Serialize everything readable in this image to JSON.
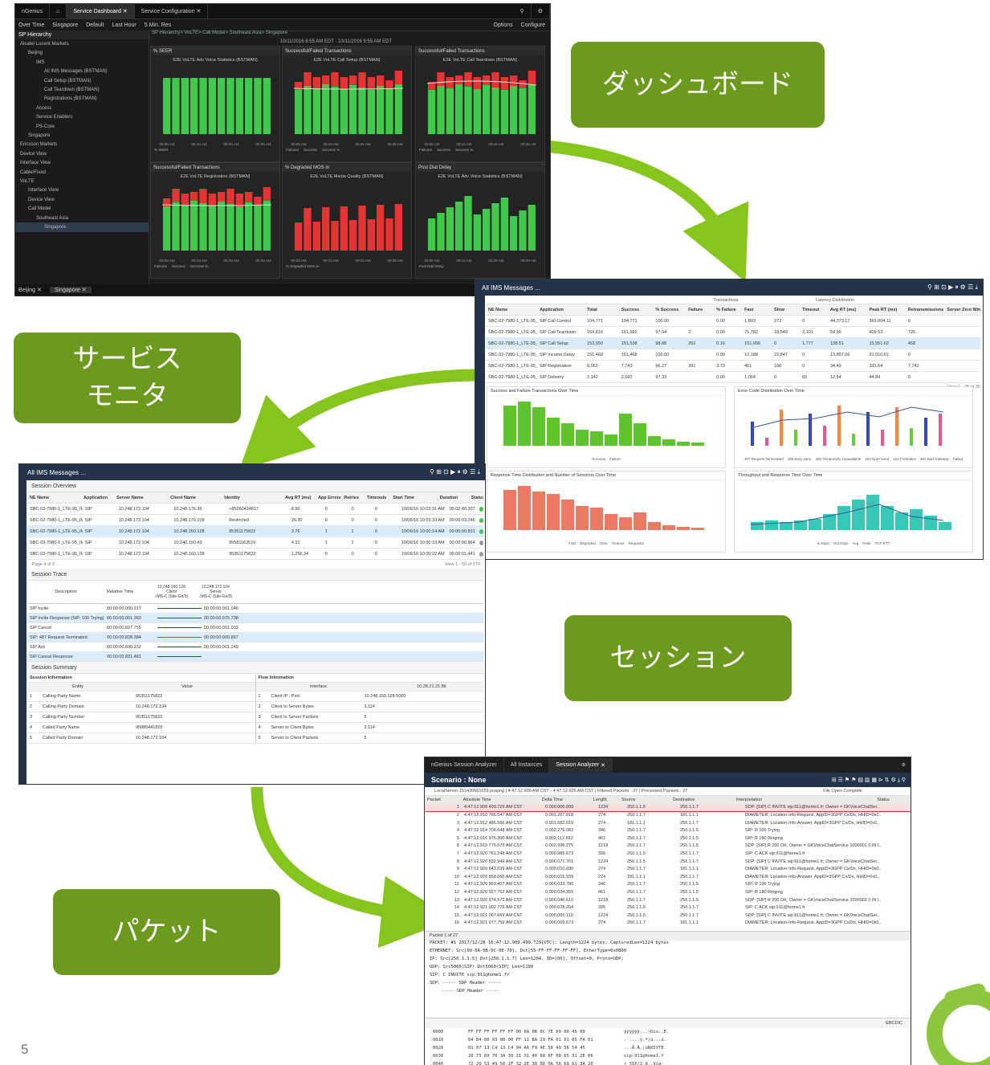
{
  "flow_labels": {
    "dashboard": "ダッシュボード",
    "service_monitor_line1": "サービス",
    "service_monitor_line2": "モニタ",
    "session": "セッション",
    "packet": "パケット"
  },
  "page_number": "5",
  "colors": {
    "label_green": "#6b9a1f",
    "arrow_green": "#86c51e",
    "logo_green": "#8dc63f",
    "success_green": "#41c94d",
    "failure_red": "#e43434"
  },
  "dashboard": {
    "app_name": "nGenius",
    "tabs": [
      "Service Dashboard",
      "Service Configuration"
    ],
    "toolbar": [
      "Over Time",
      "Singapore",
      "Default",
      "Last Hour",
      "5 Min. Res"
    ],
    "toolbar_right": [
      "Options",
      "Configure"
    ],
    "breadcrumb": "SP Hierarchy> VoLTE> Call Model> Southeast Asia> Singapore",
    "time_range": "10/11/2016 8:55 AM EDT - 10/11/2016 9:55 AM EDT",
    "tree_title": "SP Hierarchy",
    "tree": [
      "Alcatel Lucent Markets",
      "Beijing",
      "IMS",
      "All IMS Messages (BSTMAN)",
      "Call Setup (BSTMAN)",
      "Call Teardown (BSTMAN)",
      "Registrations (BSTMAN)",
      "Access",
      "Service Enablers",
      "PS-Core",
      "Singapore",
      "Ericsson Markets",
      "Device View",
      "Interface View",
      "Cable/Fixed",
      "VoLTE",
      "Interface View",
      "Device View",
      "Call Model",
      "Southeast Asia",
      "Singapore"
    ],
    "panels": [
      {
        "header": "% SEER",
        "title": "E2E VoLTE Adv Voice Statistics (BSTMAN)",
        "legend": [
          "% SEER"
        ]
      },
      {
        "header": "Successful/Failed Transactions",
        "title": "E2E VoLTE Call Setup (BSTMAN)",
        "legend": [
          "Failures",
          "Success",
          "Success %"
        ]
      },
      {
        "header": "Successful/Failed Transactions",
        "title": "E2E VoLTE Call Teardown (BSTMAN)",
        "legend": [
          "Failures",
          "Success",
          "Success %"
        ]
      },
      {
        "header": "Successful/Failed Transactions",
        "title": "E2E VoLTE Registration (BSTMAN)",
        "legend": [
          "Failures",
          "Success",
          "Success %"
        ]
      },
      {
        "header": "% Degraded MOS in",
        "title": "E2E VoLTE Media Quality (BSTMAN)",
        "legend": [
          "% Degraded MOS In"
        ]
      },
      {
        "header": "Post Dial Delay",
        "title": "E2E VoLTE Adv Voice Statistics (BSTMAN)",
        "legend": [
          "Post Dial Delay"
        ]
      }
    ],
    "xticks": [
      "09:05 AM",
      "09:15 AM",
      "09:25 AM",
      "09:35 AM"
    ],
    "bottom_tabs": [
      "Beijing",
      "Singapore"
    ]
  },
  "service_monitor": {
    "title": "All IMS Messages ...",
    "group_headers": [
      "Transactions",
      "Latency Distribution"
    ],
    "columns": [
      "NE Name",
      "Application",
      "Total",
      "Success",
      "% Success",
      "Failure",
      "% Failure",
      "Fast",
      "Slow",
      "Timeout",
      "Avg RT (ms)",
      "Peak RT (ms)",
      "Retransmissions",
      "Server Zero Window"
    ],
    "rows": [
      [
        "SBC-02-7980-1_LTE-95_IMS-C (Site-Gn/3)",
        "SIP Call Control",
        "104,771",
        "104,771",
        "100.00",
        "",
        "0.00",
        "1,803",
        "272",
        "0",
        "44,373.17",
        "365,004.11",
        "0",
        ""
      ],
      [
        "SBC-02-7980-1_LTE-95_IMS-C (Site-Gn/3)",
        "SIP Call Teardown",
        "164,816",
        "161,660",
        "97.94",
        "3",
        "0.00",
        "71,782",
        "18,549",
        "2,101",
        "54.90",
        "409.53",
        "726",
        ""
      ],
      [
        "SBC-02-7980-1_LTE-95_IMS-C (Site-Gn/3)",
        "SIP Call Setup",
        "153,550",
        "151,538",
        "98.68",
        "252",
        "0.16",
        "151,656",
        "0",
        "1,777",
        "138.51",
        "15,551.62",
        "458",
        ""
      ],
      [
        "SBC-02-7980-1_LTE-95_IMS-C (Site-Gn/3)",
        "SIP Income Delay",
        "151,468",
        "151,468",
        "100.00",
        "",
        "0.00",
        "12,188",
        "22,847",
        "0",
        "13,807.06",
        "31,010.61",
        "0",
        ""
      ],
      [
        "SBC-02-7980-1_LTE-95_IMS-C (Site-Gn/3)",
        "SIP Registration",
        "8,063",
        "7,743",
        "96.27",
        "391",
        "3.73",
        "461",
        "168",
        "0",
        "34.49",
        "331.64",
        "7,742",
        ""
      ],
      [
        "SBC-02-7980-1_LTE-95_IMS-C (Site-Gn/3)",
        "SIP Delivery",
        "2,142",
        "2,092",
        "97.33",
        "",
        "0.00",
        "1,054",
        "0",
        "60",
        "12.54",
        "44.84",
        "0",
        ""
      ]
    ],
    "footer": "View 1 - 25 of 35",
    "charts": [
      {
        "title": "Success and Failure Transactions Over Time",
        "legend": [
          "Success",
          "Failure"
        ]
      },
      {
        "title": "Error Code Distribution Over Time",
        "legend": [
          "487 Request Terminated",
          "486 Busy Here",
          "480 Temporarily Unavailable",
          "404 Not Found",
          "403 Forbidden",
          "502 Bad Gateway",
          "Failed"
        ]
      },
      {
        "title": "Response Time Distribution and Number of Sessions Over Time",
        "legend": [
          "Fast",
          "Degraded",
          "Slow",
          "Timeout",
          "Requests"
        ]
      },
      {
        "title": "Throughput and Response Time Over Time",
        "legend": [
          "In Kbps",
          "Out Kbps",
          "Avg",
          "Peak",
          "TCP RTT"
        ]
      }
    ]
  },
  "session": {
    "title": "All IMS Messages ...",
    "overview_title": "Session Overview",
    "columns": [
      "NE Name",
      "Application",
      "Server Name",
      "Client Name",
      "Identity",
      "Avg RT (ms)",
      "App Errors",
      "Retries",
      "Timeouts",
      "Start Time",
      "Duration",
      "Status"
    ],
    "rows": [
      [
        "SBC-02-7980-1_LTE-95_IMS (Site-Gn/3)",
        "SIP",
        "10.248.172.104",
        "10.248.176.36",
        "+85260434817",
        "8.90",
        "0",
        "0",
        "0",
        "10/06/16 10:03:31 AM",
        "00:02:40.307"
      ],
      [
        "SBC-02-7980-1_LTE-95_IMS (Site-Gn/3)",
        "SIP",
        "10.248.172.104",
        "10.248.176.109",
        "Restricted",
        "26.30",
        "0",
        "0",
        "0",
        "10/06/16 10:03:33 AM",
        "00:00:03.246"
      ],
      [
        "SBC-02-7980-1_LTE-95_IMS (Site-Gn/3)",
        "SIP",
        "10.248.172.104",
        "10.248.160.128",
        "95351175822",
        "3.76",
        "1",
        "1",
        "0",
        "10/06/16 10:00:14 AM",
        "00:00:00.831"
      ],
      [
        "SBC-02-7980-1_LTE-95_IMS (Site-Gn/3)",
        "SIP",
        "10.248.172.104",
        "10.240.160.43",
        "95581163516",
        "4.31",
        "1",
        "1",
        "0",
        "10/06/16 10:00:19 AM",
        "00:00:00.864"
      ],
      [
        "SBC-02-7980-1_LTE-95_IMS (Site-Gn/3)",
        "SIP",
        "10.248.172.104",
        "10.248.160.128",
        "95351175822",
        "1,256.34",
        "0",
        "0",
        "0",
        "10/06/16 10:00:22 AM",
        "00:00:01.441"
      ]
    ],
    "pager": "Page 4 of 2",
    "pager_right": "View 1 - 50 of 270",
    "trace_title": "Session Trace",
    "trace_columns": [
      "Description",
      "Relative Time"
    ],
    "trace_hosts": [
      [
        "10.248.160.128",
        "Client",
        ".IMS-C (Site-Gn/3)"
      ],
      [
        "10.248.172.104",
        "Server",
        ".IMS-C (Site-Gn/3)"
      ]
    ],
    "trace_rows": [
      [
        "SIP Invite",
        "00:00:00.000.317",
        "00:00:00.001.046"
      ],
      [
        "SIP Invite Response (SIP: 100 Trying)",
        "00:00:00.001.360",
        "00:00:00.075.738"
      ],
      [
        "SIP Cancel",
        "00:00:00.827.755",
        "00:00:00.001.033"
      ],
      [
        "SIP: 487 Request Terminated",
        "00:00:00.828.384",
        "00:00:00.000.867"
      ],
      [
        "SIP Ack",
        "00:00:00.830.232",
        "00:00:00.001.249"
      ],
      [
        "SIP Cancel Response",
        "00:00:00.831.481",
        ""
      ]
    ],
    "summary_title": "Session Summary",
    "session_info_title": "Session Information",
    "flow_info_title": "Flow Information",
    "left_cols": [
      "Entity",
      "Value"
    ],
    "right_cols": [
      "Interface",
      "10.28.21.21:86"
    ],
    "summary_left": [
      [
        "1",
        "Calling Party Name",
        "95351175822"
      ],
      [
        "2",
        "Calling Party Domain",
        "10.248.172.104"
      ],
      [
        "3",
        "Calling Party Number",
        "95351175822"
      ],
      [
        "4",
        "Called Party Name",
        "95880441655"
      ],
      [
        "5",
        "Called Party Domain",
        "10.248.172.104"
      ]
    ],
    "summary_right": [
      [
        "1",
        "Client IP : Port",
        "10.248.160.128:5060"
      ],
      [
        "2",
        "Client to Server Bytes",
        "3,114"
      ],
      [
        "3",
        "Client to Server Packets",
        "5"
      ],
      [
        "4",
        "Server to Client Bytes",
        "2,114"
      ],
      [
        "5",
        "Server to Client Packets",
        "5"
      ]
    ]
  },
  "packet": {
    "app_name": "nGenius Session Analyzer",
    "tabs": [
      "All Instances",
      "Session Analyzer"
    ],
    "title": "Scenario : None",
    "info": "LocalServer 151430661659.pcapng  |  4:47:12.909 AM CST - 4:47:12.926 AM CST  |  Filtered Packets : 27  |  Processed Packets : 27",
    "info_right": "File Open Complete",
    "columns": [
      "Packet",
      "Absolute Time",
      "Delta Time",
      "Length",
      "Source",
      "Destination",
      "Interpretation",
      "Status"
    ],
    "rows": [
      [
        "1",
        "4:47:12.909 499.729 AM CST",
        "0.000.000.000",
        "1224",
        "250.1.1.5",
        "250.1.1.7",
        "SDP: [SIP] C INVITE sip:911@home1.fr; Owner = GKVoiceChatSer.."
      ],
      [
        "2",
        "4:47:12.910 766.547 AM CST",
        "0.001.267.818",
        "274",
        "250.1.1.7",
        "181.1.1.1",
        "DIAMETER: Location-Info-Request, AppID=3GPP Cx/Dx, HHID=0x0.."
      ],
      [
        "3",
        "4:47:12.912 486.566 AM CST",
        "0.001.682.019",
        "274",
        "181.1.1.1",
        "250.1.1.7",
        "DIAMETER: Location-Info-Answer, AppID=3GPP Cx/Dx, HHID=0x0.."
      ],
      [
        "4",
        "4:47:12.914 706.648 AM CST",
        "0.002.276.082",
        "346",
        "250.1.1.7",
        "250.1.1.5",
        "SIP: R 100 Trying"
      ],
      [
        "5",
        "4:47:12.916 976.300 AM CST",
        "0.002.112.652",
        "461",
        "250.1.1.7",
        "250.1.1.5",
        "SIP: R 180 Ringing"
      ],
      [
        "6",
        "4:47:12.919 775.575 AM CST",
        "0.002.996.275",
        "1218",
        "250.1.1.7",
        "250.1.1.5",
        "SDP: [SIP] R 200 OK; Owner = GKVoiceChatService 1000001 0 IN I.."
      ],
      [
        "7",
        "4:47:12.920 761.248 AM CST",
        "0.000.985.673",
        "395",
        "250.1.1.5",
        "250.1.1.7",
        "SIP: C ACK sip:911@home1.fr"
      ],
      [
        "8",
        "4:47:12.920 832.949 AM CST",
        "0.000.071.701",
        "1224",
        "250.1.1.5",
        "250.1.1.7",
        "SDP: [SIP] C INVITE sip:911@home1.fr; Owner = GKVoiceChatSer.."
      ],
      [
        "9",
        "4:47:12.920 843.639 AM CST",
        "0.000.010.690",
        "274",
        "250.1.1.7",
        "181.1.1.1",
        "DIAMETER: Location-Info-Request, AppID=3GPP Cx/Dx, HHID=0x0.."
      ],
      [
        "10",
        "4:47:12.920 858.066 AM CST",
        "0.000.015.939",
        "274",
        "181.1.1.1",
        "250.1.1.7",
        "DIAMETER: Location-Info-Answer, AppID=3GPP Cx/Dx, HHID=0x0.."
      ],
      [
        "11",
        "4:47:12.920 893.407 AM CST",
        "0.000.033.780",
        "346",
        "250.1.1.7",
        "250.1.1.5",
        "SIP: R 100 Trying"
      ],
      [
        "12",
        "4:47:12.920 927.762 AM CST",
        "0.000.034.355",
        "461",
        "250.1.1.7",
        "250.1.1.5",
        "SIP: R 180 Ringing"
      ],
      [
        "13",
        "4:47:12.920 974.572 AM CST",
        "0.000.046.610",
        "1218",
        "250.1.1.7",
        "250.1.1.5",
        "SDP: [SIP] R 200 OK; Owner = GKVoiceChatService 1000002 0 IN I.."
      ],
      [
        "14",
        "4:47:12.921 002.776 AM CST",
        "0.000.028.204",
        "395",
        "250.1.1.5",
        "250.1.1.7",
        "SIP: C ACK sip:911@home1.fr"
      ],
      [
        "15",
        "4:47:12.921 067.669 AM CST",
        "0.000.065.110",
        "1224",
        "250.1.1.5",
        "250.1.1.7",
        "SDP: [SIP] C INVITE sip:911@home1.fr; Owner = GKVoiceChatSer.."
      ],
      [
        "16",
        "4:47:12.921 077.759 AM CST",
        "0.000.009.673",
        "274",
        "250.1.1.7",
        "181.1.1.1",
        "DIAMETER: Location-Info-Request, AppID=3GPP Cx/Dx, HHID=0x0.."
      ]
    ],
    "pager": "Packet 1 of 27",
    "decode": [
      "PACKET: #1 2017/12/28 10:47:12.909.499.729[UTC]; Length=1224 bytes; CapturedLen=1224 bytes",
      "ETHERNET: Src[00-0A-0B-0C-0E-70], Dst[55-FF-FF-FF-FF-FF], EtherType=0x0800",
      "IP: Src[250.1.1.5] Dst[250.1.1.7] Len=1204, ID=[00], Offset=0, Proto=UDP;",
      "UDP: Src5060(SIP) Dst5060(SIP) Len=1190",
      "SIP: C INVITE sip:911@home1.fr",
      "SDP: ----- SDP Header -----",
      "----- SDP Header -----"
    ],
    "hex_label": "EBCDIC",
    "hex": [
      [
        "0000",
        "FF FF FF FF FF FF 00 0A 0B 0C 7E 00 00 45 00",
        "ÿÿÿÿÿÿ...~Dio..E."
      ],
      [
        "0010",
        "04 B4 00 03 00 00 FF 11 BA 29 FA 01 01 05 FA 01",
        ".´....ÿ.º)ú...ú."
      ],
      [
        "0020",
        "01 07 13 C4 13 C4 04 A6 F9 4E 58 49 56 54 45",
        "...Ä.Ä.¦ùNXIVTE"
      ],
      [
        "0030",
        "20 73 69 70 3A 39 31 31 40 68 6F 6D 65 31 2E 66",
        " sip:911@home1.f"
      ],
      [
        "0040",
        "72 20 53 49 50 2F 32 2E 30 0D 0A 56 69 61 3A 20",
        "r SIP/2.0..Via: "
      ],
      [
        "0050",
        "53 49 50 2F 32 2E 30 2F 55 44 50 20 32 35 30 2E",
        "SIP/2.0/UDP 250."
      ]
    ]
  }
}
